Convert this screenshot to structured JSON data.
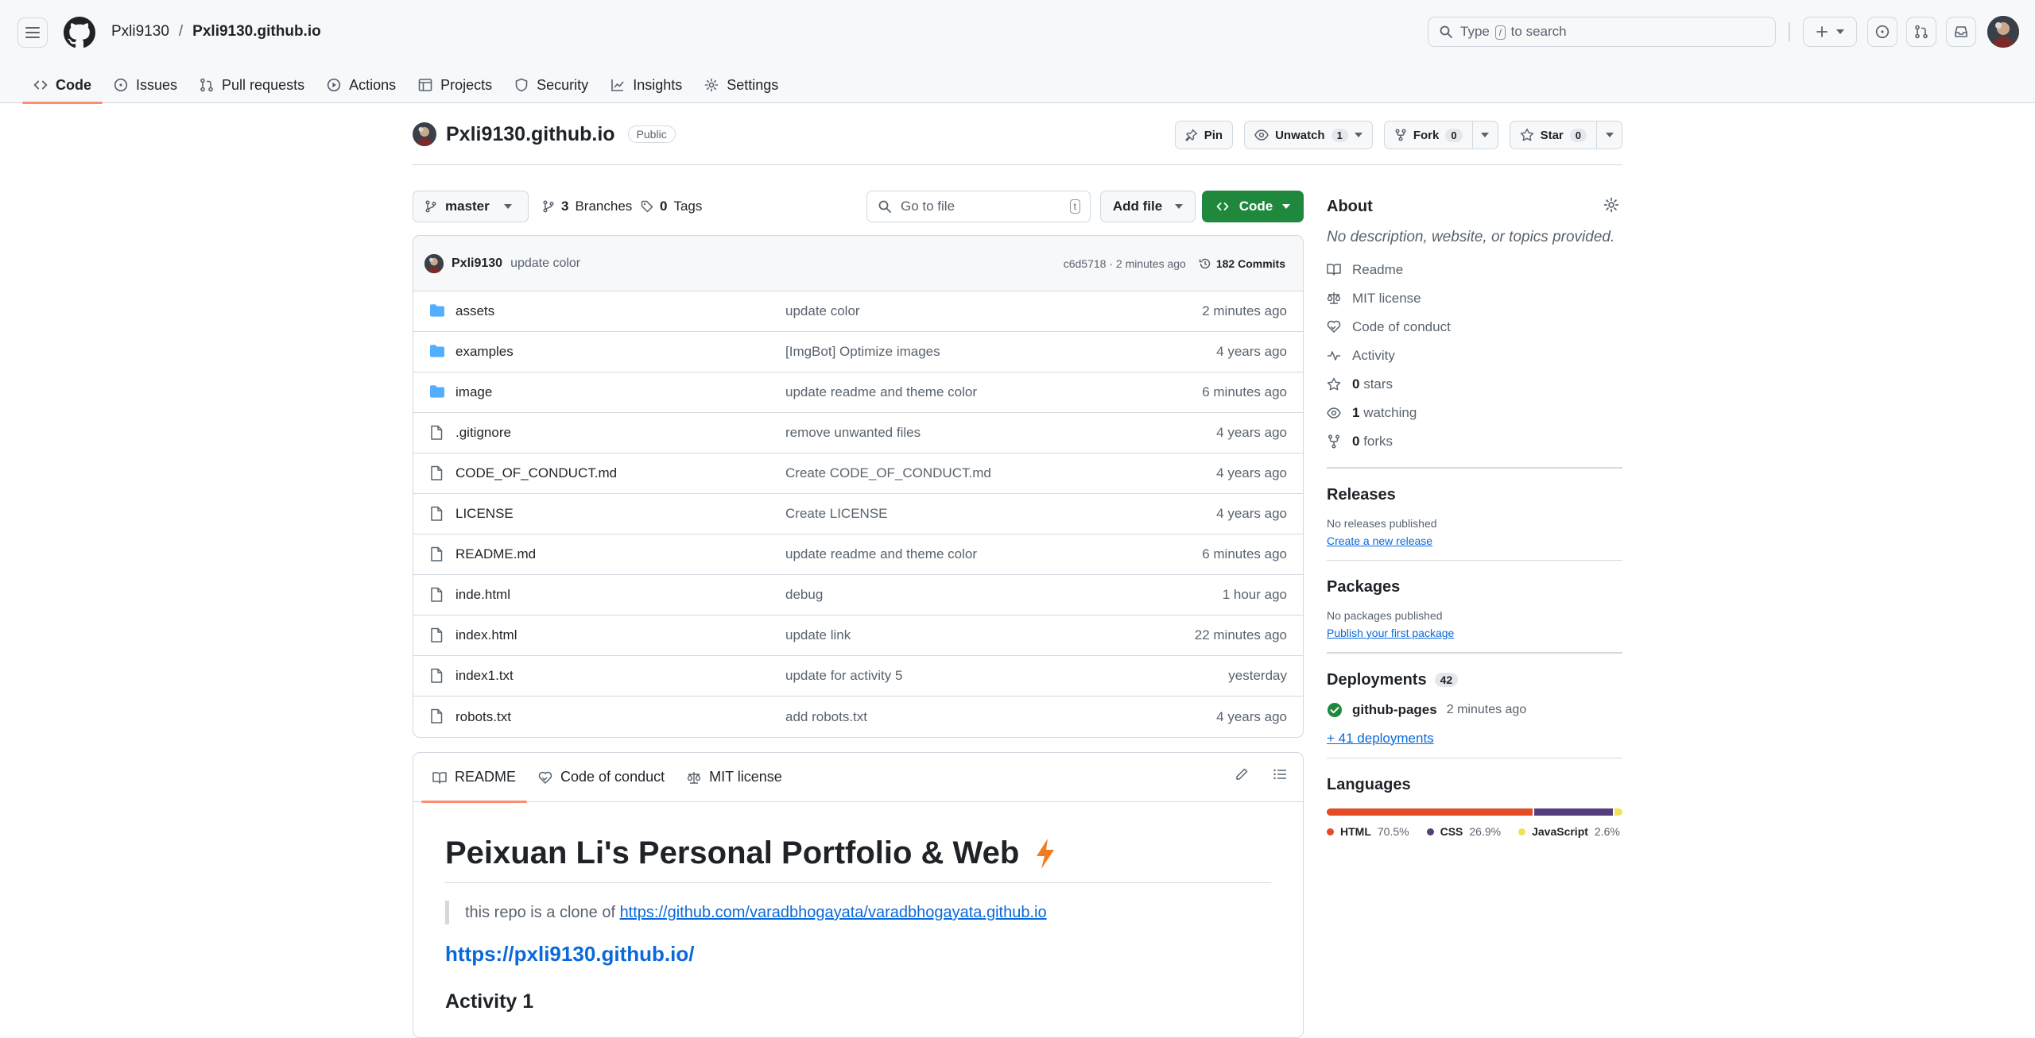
{
  "header": {
    "owner": "Pxli9130",
    "separator": "/",
    "repo": "Pxli9130.github.io",
    "search_prefix": "Type",
    "search_key": "/",
    "search_suffix": "to search"
  },
  "tabs": [
    {
      "label": "Code",
      "icon": "code-icon",
      "active": true
    },
    {
      "label": "Issues",
      "icon": "issue-icon"
    },
    {
      "label": "Pull requests",
      "icon": "pull-request-icon"
    },
    {
      "label": "Actions",
      "icon": "play-icon"
    },
    {
      "label": "Projects",
      "icon": "table-icon"
    },
    {
      "label": "Security",
      "icon": "shield-icon"
    },
    {
      "label": "Insights",
      "icon": "graph-icon"
    },
    {
      "label": "Settings",
      "icon": "gear-icon"
    }
  ],
  "repo": {
    "name": "Pxli9130.github.io",
    "visibility": "Public",
    "pin_label": "Pin",
    "unwatch_label": "Unwatch",
    "watch_count": "1",
    "fork_label": "Fork",
    "fork_count": "0",
    "star_label": "Star",
    "star_count": "0"
  },
  "controls": {
    "branch": "master",
    "branches_count": "3",
    "branches_label": "Branches",
    "tags_count": "0",
    "tags_label": "Tags",
    "goto_placeholder": "Go to file",
    "goto_key": "t",
    "add_file": "Add file",
    "code": "Code"
  },
  "commit": {
    "author": "Pxli9130",
    "message": "update color",
    "hash_time": "c6d5718 · 2 minutes ago",
    "count_label": "182 Commits"
  },
  "files": [
    {
      "name": "assets",
      "type": "folder",
      "message": "update color",
      "time": "2 minutes ago"
    },
    {
      "name": "examples",
      "type": "folder",
      "message": "[ImgBot] Optimize images",
      "time": "4 years ago"
    },
    {
      "name": "image",
      "type": "folder",
      "message": "update readme and theme color",
      "time": "6 minutes ago"
    },
    {
      "name": ".gitignore",
      "type": "file",
      "message": "remove unwanted files",
      "time": "4 years ago"
    },
    {
      "name": "CODE_OF_CONDUCT.md",
      "type": "file",
      "message": "Create CODE_OF_CONDUCT.md",
      "time": "4 years ago"
    },
    {
      "name": "LICENSE",
      "type": "file",
      "message": "Create LICENSE",
      "time": "4 years ago"
    },
    {
      "name": "README.md",
      "type": "file",
      "message": "update readme and theme color",
      "time": "6 minutes ago"
    },
    {
      "name": "inde.html",
      "type": "file",
      "message": "debug",
      "time": "1 hour ago"
    },
    {
      "name": "index.html",
      "type": "file",
      "message": "update link",
      "time": "22 minutes ago"
    },
    {
      "name": "index1.txt",
      "type": "file",
      "message": "update for activity 5",
      "time": "yesterday"
    },
    {
      "name": "robots.txt",
      "type": "file",
      "message": "add robots.txt",
      "time": "4 years ago"
    }
  ],
  "readme": {
    "tabs": [
      "README",
      "Code of conduct",
      "MIT license"
    ],
    "title": "Peixuan Li's Personal Portfolio & Web",
    "quote_prefix": "this repo is a clone of",
    "quote_link": "https://github.com/varadbhogayata/varadbhogayata.github.io",
    "site_link": "https://pxli9130.github.io/",
    "heading": "Activity 1"
  },
  "about": {
    "title": "About",
    "description": "No description, website, or topics provided.",
    "items": [
      {
        "icon": "book-icon",
        "count": "",
        "label": "Readme"
      },
      {
        "icon": "law-icon",
        "count": "",
        "label": "MIT license"
      },
      {
        "icon": "code-of-conduct-icon",
        "count": "",
        "label": "Code of conduct"
      },
      {
        "icon": "pulse-icon",
        "count": "",
        "label": "Activity"
      },
      {
        "icon": "star-icon",
        "count": "0",
        "label": "stars"
      },
      {
        "icon": "eye-icon",
        "count": "1",
        "label": "watching"
      },
      {
        "icon": "fork-icon",
        "count": "0",
        "label": "forks"
      }
    ]
  },
  "releases": {
    "title": "Releases",
    "empty": "No releases published",
    "link": "Create a new release"
  },
  "packages": {
    "title": "Packages",
    "empty": "No packages published",
    "link": "Publish your first package"
  },
  "deployments": {
    "title": "Deployments",
    "count": "42",
    "env": "github-pages",
    "time": "2 minutes ago",
    "more": "+ 41 deployments"
  },
  "languages": {
    "title": "Languages",
    "items": [
      {
        "name": "HTML",
        "percent": "70.5%",
        "value": 70.5,
        "color": "#e34c26"
      },
      {
        "name": "CSS",
        "percent": "26.9%",
        "value": 26.9,
        "color": "#563d7c"
      },
      {
        "name": "JavaScript",
        "percent": "2.6%",
        "value": 2.6,
        "color": "#f1e05a"
      }
    ]
  }
}
